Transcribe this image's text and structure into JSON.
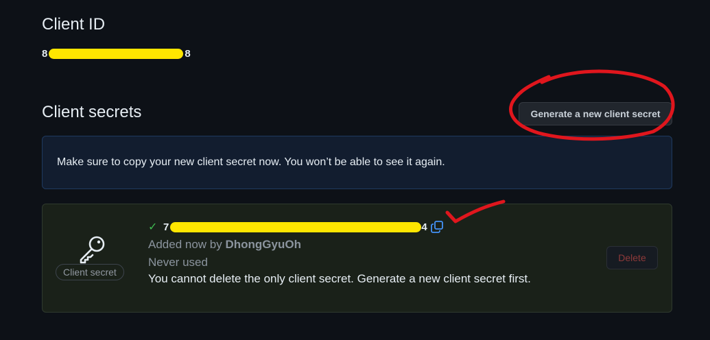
{
  "client_id": {
    "title": "Client ID",
    "value_start": "8",
    "value_end": "8"
  },
  "client_secrets": {
    "title": "Client secrets",
    "generate_button_label": "Generate a new client secret",
    "flash_message": "Make sure to copy your new client secret now. You won’t be able to see it again.",
    "secret": {
      "badge_label": "Client secret",
      "value_start": "7",
      "value_end": "4",
      "added_prefix": "Added now by",
      "added_by": "DhongGyuOh",
      "usage": "Never used",
      "delete_note": "You cannot delete the only client secret. Generate a new client secret first.",
      "delete_button_label": "Delete",
      "icons": [
        "key-icon",
        "check-icon",
        "copy-icon"
      ]
    }
  },
  "colors": {
    "background": "#0d1117",
    "flash_bg": "#121d2f",
    "secret_bg": "#1a2119",
    "redaction": "#ffe600",
    "annotation": "#e0161d",
    "success": "#3fb950",
    "danger": "#8e3a3a"
  }
}
